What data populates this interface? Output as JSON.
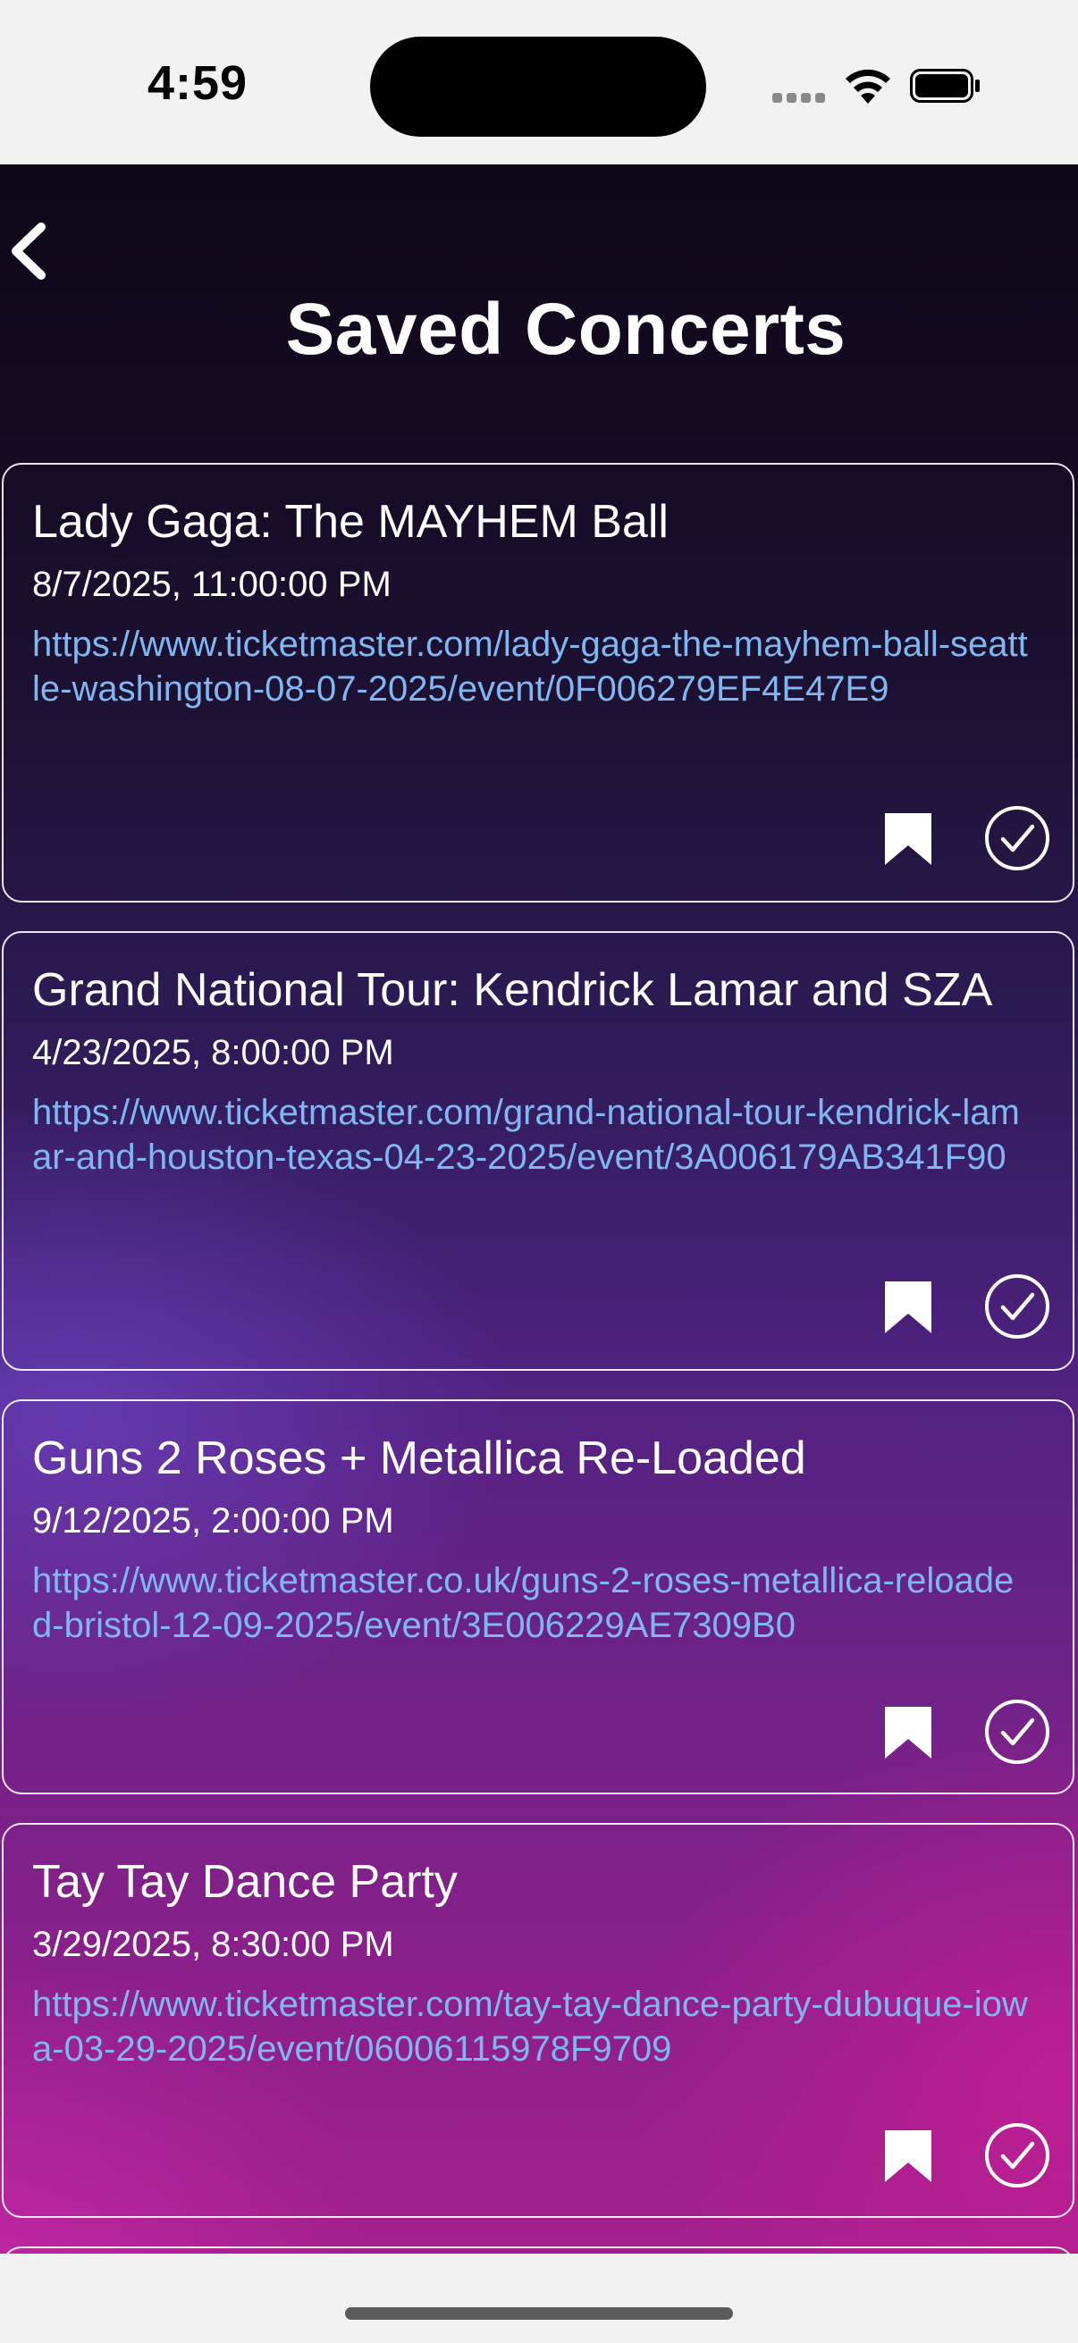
{
  "status_bar": {
    "time": "4:59"
  },
  "header": {
    "title": "Saved Concerts",
    "back_icon": "chevron-left-icon"
  },
  "concerts": [
    {
      "title": "Lady Gaga: The MAYHEM Ball",
      "datetime": "8/7/2025, 11:00:00 PM",
      "url": "https://www.ticketmaster.com/lady-gaga-the-mayhem-ball-seattle-washington-08-07-2025/event/0F006279EF4E47E9"
    },
    {
      "title": "Grand National Tour: Kendrick Lamar and SZA",
      "datetime": "4/23/2025, 8:00:00 PM",
      "url": "https://www.ticketmaster.com/grand-national-tour-kendrick-lamar-and-houston-texas-04-23-2025/event/3A006179AB341F90"
    },
    {
      "title": "Guns 2 Roses + Metallica Re-Loaded",
      "datetime": "9/12/2025, 2:00:00 PM",
      "url": "https://www.ticketmaster.co.uk/guns-2-roses-metallica-reloaded-bristol-12-09-2025/event/3E006229AE7309B0"
    },
    {
      "title": "Tay Tay Dance Party",
      "datetime": "3/29/2025, 8:30:00 PM",
      "url": "https://www.ticketmaster.com/tay-tay-dance-party-dubuque-iowa-03-29-2025/event/06006115978F9709"
    }
  ],
  "colors": {
    "link": "#7fb7f2",
    "text": "#ffffff"
  }
}
